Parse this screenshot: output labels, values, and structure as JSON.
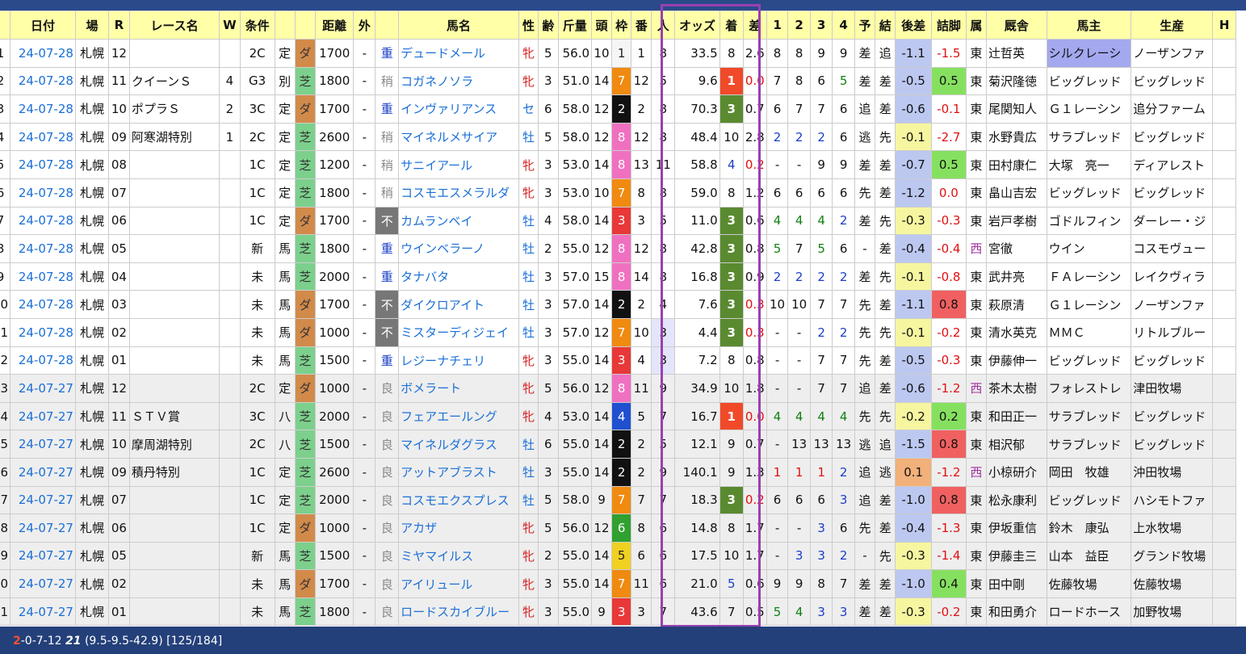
{
  "headers": [
    "",
    "日付",
    "場",
    "R",
    "レース名",
    "W",
    "条件",
    "",
    "",
    "距離",
    "外",
    "",
    "馬名",
    "性",
    "齢",
    "斤量",
    "頭",
    "枠",
    "番",
    "人",
    "オッズ",
    "着",
    "差",
    "1",
    "2",
    "3",
    "4",
    "予",
    "結",
    "後差",
    "詰脚",
    "属",
    "厩舎",
    "馬主",
    "生産",
    "H"
  ],
  "rows": [
    {
      "no": "1",
      "date": "24-07-28",
      "place": "札幌",
      "r": "12",
      "race": "",
      "w": "",
      "cls": "2C",
      "kind": "定",
      "surf": "ダ",
      "dist": "1700",
      "out": "-",
      "track": "重",
      "horse": "デュードメール",
      "sex": "牝",
      "age": "5",
      "wt": "56.0",
      "heads": "10",
      "gate": "1",
      "num": "1",
      "pop": "8",
      "odds": "33.5",
      "pos": "8",
      "diff": "2.6",
      "c1": "8",
      "c2": "8",
      "c3": "9",
      "c4": "9",
      "yo": "差",
      "res": "追",
      "ato": "-1.1",
      "tsume": "-1.5",
      "zoku": "東",
      "trainer": "辻哲英",
      "owner": "シルクレーシ",
      "breeder": "ノーザンファ"
    },
    {
      "no": "2",
      "date": "24-07-28",
      "place": "札幌",
      "r": "11",
      "race": "クイーンＳ",
      "w": "4",
      "cls": "G3",
      "kind": "別",
      "surf": "芝",
      "dist": "1800",
      "out": "-",
      "track": "稍",
      "horse": "コガネノソラ",
      "sex": "牝",
      "age": "3",
      "wt": "51.0",
      "heads": "14",
      "gate": "7",
      "num": "12",
      "pop": "5",
      "odds": "9.6",
      "pos": "1",
      "diff": "0.0",
      "c1": "7",
      "c2": "8",
      "c3": "6",
      "c4": "5",
      "yo": "差",
      "res": "差",
      "ato": "-0.5",
      "tsume": "0.5",
      "zoku": "東",
      "trainer": "菊沢隆徳",
      "owner": "ビッグレッド",
      "breeder": "ビッグレッド"
    },
    {
      "no": "3",
      "date": "24-07-28",
      "place": "札幌",
      "r": "10",
      "race": "ポプラＳ",
      "w": "2",
      "cls": "3C",
      "kind": "定",
      "surf": "ダ",
      "dist": "1700",
      "out": "-",
      "track": "重",
      "horse": "インヴァリアンス",
      "sex": "セ",
      "age": "6",
      "wt": "58.0",
      "heads": "12",
      "gate": "2",
      "num": "2",
      "pop": "8",
      "odds": "70.3",
      "pos": "3",
      "diff": "0.7",
      "c1": "6",
      "c2": "7",
      "c3": "7",
      "c4": "6",
      "yo": "追",
      "res": "差",
      "ato": "-0.6",
      "tsume": "-0.1",
      "zoku": "東",
      "trainer": "尾関知人",
      "owner": "Ｇ１レーシン",
      "breeder": "追分ファーム"
    },
    {
      "no": "4",
      "date": "24-07-28",
      "place": "札幌",
      "r": "09",
      "race": "阿寒湖特別",
      "w": "1",
      "cls": "2C",
      "kind": "定",
      "surf": "芝",
      "dist": "2600",
      "out": "-",
      "track": "稍",
      "horse": "マイネルメサイア",
      "sex": "牡",
      "age": "5",
      "wt": "58.0",
      "heads": "12",
      "gate": "8",
      "num": "12",
      "pop": "8",
      "odds": "48.4",
      "pos": "10",
      "diff": "2.8",
      "c1": "2",
      "c2": "2",
      "c3": "2",
      "c4": "6",
      "yo": "逃",
      "res": "先",
      "ato": "-0.1",
      "tsume": "-2.7",
      "zoku": "東",
      "trainer": "水野貴広",
      "owner": "サラブレッド",
      "breeder": "ビッグレッド"
    },
    {
      "no": "5",
      "date": "24-07-28",
      "place": "札幌",
      "r": "08",
      "race": "",
      "w": "",
      "cls": "1C",
      "kind": "定",
      "surf": "芝",
      "dist": "1200",
      "out": "-",
      "track": "稍",
      "horse": "サニイアール",
      "sex": "牝",
      "age": "3",
      "wt": "53.0",
      "heads": "14",
      "gate": "8",
      "num": "13",
      "pop": "11",
      "odds": "58.8",
      "pos": "4",
      "diff": "0.2",
      "c1": "-",
      "c2": "-",
      "c3": "9",
      "c4": "9",
      "yo": "差",
      "res": "差",
      "ato": "-0.7",
      "tsume": "0.5",
      "zoku": "東",
      "trainer": "田村康仁",
      "owner": "大塚　亮一",
      "breeder": "ディアレスト"
    },
    {
      "no": "6",
      "date": "24-07-28",
      "place": "札幌",
      "r": "07",
      "race": "",
      "w": "",
      "cls": "1C",
      "kind": "定",
      "surf": "芝",
      "dist": "1800",
      "out": "-",
      "track": "稍",
      "horse": "コスモエスメラルダ",
      "sex": "牝",
      "age": "3",
      "wt": "53.0",
      "heads": "10",
      "gate": "7",
      "num": "8",
      "pop": "8",
      "odds": "59.0",
      "pos": "8",
      "diff": "1.2",
      "c1": "6",
      "c2": "6",
      "c3": "6",
      "c4": "6",
      "yo": "先",
      "res": "差",
      "ato": "-1.2",
      "tsume": "0.0",
      "zoku": "東",
      "trainer": "畠山吉宏",
      "owner": "ビッグレッド",
      "breeder": "ビッグレッド"
    },
    {
      "no": "7",
      "date": "24-07-28",
      "place": "札幌",
      "r": "06",
      "race": "",
      "w": "",
      "cls": "1C",
      "kind": "定",
      "surf": "ダ",
      "dist": "1700",
      "out": "-",
      "track": "不",
      "horse": "カムランベイ",
      "sex": "牡",
      "age": "4",
      "wt": "58.0",
      "heads": "14",
      "gate": "3",
      "num": "3",
      "pop": "5",
      "odds": "11.0",
      "pos": "3",
      "diff": "0.6",
      "c1": "4",
      "c2": "4",
      "c3": "4",
      "c4": "2",
      "yo": "差",
      "res": "先",
      "ato": "-0.3",
      "tsume": "-0.3",
      "zoku": "東",
      "trainer": "岩戸孝樹",
      "owner": "ゴドルフィン",
      "breeder": "ダーレー・ジ"
    },
    {
      "no": "8",
      "date": "24-07-28",
      "place": "札幌",
      "r": "05",
      "race": "",
      "w": "",
      "cls": "新",
      "kind": "馬",
      "surf": "芝",
      "dist": "1800",
      "out": "-",
      "track": "重",
      "horse": "ウインベラーノ",
      "sex": "牡",
      "age": "2",
      "wt": "55.0",
      "heads": "12",
      "gate": "8",
      "num": "12",
      "pop": "8",
      "odds": "42.8",
      "pos": "3",
      "diff": "0.8",
      "c1": "5",
      "c2": "7",
      "c3": "5",
      "c4": "6",
      "yo": "-",
      "res": "差",
      "ato": "-0.4",
      "tsume": "-0.4",
      "zoku": "西",
      "trainer": "宮徹",
      "owner": "ウイン",
      "breeder": "コスモヴュー"
    },
    {
      "no": "9",
      "date": "24-07-28",
      "place": "札幌",
      "r": "04",
      "race": "",
      "w": "",
      "cls": "未",
      "kind": "馬",
      "surf": "芝",
      "dist": "2000",
      "out": "-",
      "track": "重",
      "horse": "タナバタ",
      "sex": "牡",
      "age": "3",
      "wt": "57.0",
      "heads": "15",
      "gate": "8",
      "num": "14",
      "pop": "8",
      "odds": "16.8",
      "pos": "3",
      "diff": "0.9",
      "c1": "2",
      "c2": "2",
      "c3": "2",
      "c4": "2",
      "yo": "差",
      "res": "先",
      "ato": "-0.1",
      "tsume": "-0.8",
      "zoku": "東",
      "trainer": "武井亮",
      "owner": "ＦＡレーシン",
      "breeder": "レイクヴィラ"
    },
    {
      "no": "10",
      "date": "24-07-28",
      "place": "札幌",
      "r": "03",
      "race": "",
      "w": "",
      "cls": "未",
      "kind": "馬",
      "surf": "ダ",
      "dist": "1700",
      "out": "-",
      "track": "不",
      "horse": "ダイクロアイト",
      "sex": "牡",
      "age": "3",
      "wt": "57.0",
      "heads": "14",
      "gate": "2",
      "num": "2",
      "pop": "4",
      "odds": "7.6",
      "pos": "3",
      "diff": "0.3",
      "c1": "10",
      "c2": "10",
      "c3": "7",
      "c4": "7",
      "yo": "先",
      "res": "差",
      "ato": "-1.1",
      "tsume": "0.8",
      "zoku": "東",
      "trainer": "萩原清",
      "owner": "Ｇ１レーシン",
      "breeder": "ノーザンファ"
    },
    {
      "no": "11",
      "date": "24-07-28",
      "place": "札幌",
      "r": "02",
      "race": "",
      "w": "",
      "cls": "未",
      "kind": "馬",
      "surf": "ダ",
      "dist": "1000",
      "out": "-",
      "track": "不",
      "horse": "ミスターディジェイ",
      "sex": "牡",
      "age": "3",
      "wt": "57.0",
      "heads": "12",
      "gate": "7",
      "num": "10",
      "pop": "3",
      "odds": "4.4",
      "pos": "3",
      "diff": "0.3",
      "c1": "-",
      "c2": "-",
      "c3": "2",
      "c4": "2",
      "yo": "先",
      "res": "先",
      "ato": "-0.1",
      "tsume": "-0.2",
      "zoku": "東",
      "trainer": "清水英克",
      "owner": "ＭＭＣ",
      "breeder": "リトルブルー"
    },
    {
      "no": "12",
      "date": "24-07-28",
      "place": "札幌",
      "r": "01",
      "race": "",
      "w": "",
      "cls": "未",
      "kind": "馬",
      "surf": "芝",
      "dist": "1500",
      "out": "-",
      "track": "重",
      "horse": "レジーナチェリ",
      "sex": "牝",
      "age": "3",
      "wt": "55.0",
      "heads": "14",
      "gate": "3",
      "num": "4",
      "pop": "3",
      "odds": "7.2",
      "pos": "8",
      "diff": "0.8",
      "c1": "-",
      "c2": "-",
      "c3": "7",
      "c4": "7",
      "yo": "先",
      "res": "差",
      "ato": "-0.5",
      "tsume": "-0.3",
      "zoku": "東",
      "trainer": "伊藤伸一",
      "owner": "ビッグレッド",
      "breeder": "ビッグレッド"
    },
    {
      "no": "13",
      "date": "24-07-27",
      "place": "札幌",
      "r": "12",
      "race": "",
      "w": "",
      "cls": "2C",
      "kind": "定",
      "surf": "ダ",
      "dist": "1000",
      "out": "-",
      "track": "良",
      "horse": "ボメラート",
      "sex": "牝",
      "age": "5",
      "wt": "56.0",
      "heads": "12",
      "gate": "8",
      "num": "11",
      "pop": "9",
      "odds": "34.9",
      "pos": "10",
      "diff": "1.8",
      "c1": "-",
      "c2": "-",
      "c3": "7",
      "c4": "7",
      "yo": "追",
      "res": "差",
      "ato": "-0.6",
      "tsume": "-1.2",
      "zoku": "西",
      "trainer": "茶木太樹",
      "owner": "フォレストレ",
      "breeder": "津田牧場"
    },
    {
      "no": "14",
      "date": "24-07-27",
      "place": "札幌",
      "r": "11",
      "race": "ＳＴＶ賞",
      "w": "",
      "cls": "3C",
      "kind": "八",
      "surf": "芝",
      "dist": "2000",
      "out": "-",
      "track": "良",
      "horse": "フェアエールング",
      "sex": "牝",
      "age": "4",
      "wt": "53.0",
      "heads": "14",
      "gate": "4",
      "num": "5",
      "pop": "7",
      "odds": "16.7",
      "pos": "1",
      "diff": "0.0",
      "c1": "4",
      "c2": "4",
      "c3": "4",
      "c4": "4",
      "yo": "先",
      "res": "先",
      "ato": "-0.2",
      "tsume": "0.2",
      "zoku": "東",
      "trainer": "和田正一",
      "owner": "サラブレッド",
      "breeder": "ビッグレッド"
    },
    {
      "no": "15",
      "date": "24-07-27",
      "place": "札幌",
      "r": "10",
      "race": "摩周湖特別",
      "w": "",
      "cls": "2C",
      "kind": "八",
      "surf": "芝",
      "dist": "1500",
      "out": "-",
      "track": "良",
      "horse": "マイネルダグラス",
      "sex": "牡",
      "age": "6",
      "wt": "55.0",
      "heads": "14",
      "gate": "2",
      "num": "2",
      "pop": "5",
      "odds": "12.1",
      "pos": "9",
      "diff": "0.7",
      "c1": "-",
      "c2": "13",
      "c3": "13",
      "c4": "13",
      "yo": "逃",
      "res": "追",
      "ato": "-1.5",
      "tsume": "0.8",
      "zoku": "東",
      "trainer": "相沢郁",
      "owner": "サラブレッド",
      "breeder": "ビッグレッド"
    },
    {
      "no": "16",
      "date": "24-07-27",
      "place": "札幌",
      "r": "09",
      "race": "積丹特別",
      "w": "",
      "cls": "1C",
      "kind": "定",
      "surf": "芝",
      "dist": "2600",
      "out": "-",
      "track": "良",
      "horse": "アットアブラスト",
      "sex": "牡",
      "age": "3",
      "wt": "55.0",
      "heads": "14",
      "gate": "2",
      "num": "2",
      "pop": "9",
      "odds": "140.1",
      "pos": "9",
      "diff": "1.3",
      "c1": "1",
      "c2": "1",
      "c3": "1",
      "c4": "2",
      "yo": "追",
      "res": "逃",
      "ato": "0.1",
      "tsume": "-1.2",
      "zoku": "西",
      "trainer": "小椋研介",
      "owner": "岡田　牧雄",
      "breeder": "沖田牧場"
    },
    {
      "no": "17",
      "date": "24-07-27",
      "place": "札幌",
      "r": "07",
      "race": "",
      "w": "",
      "cls": "1C",
      "kind": "定",
      "surf": "芝",
      "dist": "2000",
      "out": "-",
      "track": "良",
      "horse": "コスモエクスプレス",
      "sex": "牡",
      "age": "5",
      "wt": "58.0",
      "heads": "9",
      "gate": "7",
      "num": "7",
      "pop": "7",
      "odds": "18.3",
      "pos": "3",
      "diff": "0.2",
      "c1": "6",
      "c2": "6",
      "c3": "6",
      "c4": "3",
      "yo": "追",
      "res": "差",
      "ato": "-1.0",
      "tsume": "0.8",
      "zoku": "東",
      "trainer": "松永康利",
      "owner": "ビッグレッド",
      "breeder": "ハシモトファ"
    },
    {
      "no": "18",
      "date": "24-07-27",
      "place": "札幌",
      "r": "06",
      "race": "",
      "w": "",
      "cls": "1C",
      "kind": "定",
      "surf": "ダ",
      "dist": "1000",
      "out": "-",
      "track": "良",
      "horse": "アカザ",
      "sex": "牝",
      "age": "5",
      "wt": "56.0",
      "heads": "12",
      "gate": "6",
      "num": "8",
      "pop": "6",
      "odds": "14.8",
      "pos": "8",
      "diff": "1.7",
      "c1": "-",
      "c2": "-",
      "c3": "3",
      "c4": "6",
      "yo": "先",
      "res": "差",
      "ato": "-0.4",
      "tsume": "-1.3",
      "zoku": "東",
      "trainer": "伊坂重信",
      "owner": "鈴木　康弘",
      "breeder": "上水牧場"
    },
    {
      "no": "19",
      "date": "24-07-27",
      "place": "札幌",
      "r": "05",
      "race": "",
      "w": "",
      "cls": "新",
      "kind": "馬",
      "surf": "芝",
      "dist": "1500",
      "out": "-",
      "track": "良",
      "horse": "ミヤマイルス",
      "sex": "牝",
      "age": "2",
      "wt": "55.0",
      "heads": "14",
      "gate": "5",
      "num": "6",
      "pop": "6",
      "odds": "17.5",
      "pos": "10",
      "diff": "1.7",
      "c1": "-",
      "c2": "3",
      "c3": "3",
      "c4": "2",
      "yo": "-",
      "res": "先",
      "ato": "-0.3",
      "tsume": "-1.4",
      "zoku": "東",
      "trainer": "伊藤圭三",
      "owner": "山本　益臣",
      "breeder": "グランド牧場"
    },
    {
      "no": "20",
      "date": "24-07-27",
      "place": "札幌",
      "r": "02",
      "race": "",
      "w": "",
      "cls": "未",
      "kind": "馬",
      "surf": "ダ",
      "dist": "1700",
      "out": "-",
      "track": "良",
      "horse": "アイリュール",
      "sex": "牝",
      "age": "3",
      "wt": "55.0",
      "heads": "14",
      "gate": "7",
      "num": "11",
      "pop": "6",
      "odds": "21.0",
      "pos": "5",
      "diff": "0.6",
      "c1": "9",
      "c2": "9",
      "c3": "8",
      "c4": "7",
      "yo": "差",
      "res": "差",
      "ato": "-1.0",
      "tsume": "0.4",
      "zoku": "東",
      "trainer": "田中剛",
      "owner": "佐藤牧場",
      "breeder": "佐藤牧場"
    },
    {
      "no": "21",
      "date": "24-07-27",
      "place": "札幌",
      "r": "01",
      "race": "",
      "w": "",
      "cls": "未",
      "kind": "馬",
      "surf": "芝",
      "dist": "1800",
      "out": "-",
      "track": "良",
      "horse": "ロードスカイブルー",
      "sex": "牝",
      "age": "3",
      "wt": "55.0",
      "heads": "9",
      "gate": "3",
      "num": "3",
      "pop": "7",
      "odds": "43.6",
      "pos": "7",
      "diff": "0.5",
      "c1": "5",
      "c2": "4",
      "c3": "3",
      "c4": "3",
      "yo": "差",
      "res": "差",
      "ato": "-0.3",
      "tsume": "-0.2",
      "zoku": "東",
      "trainer": "和田勇介",
      "owner": "ロードホース",
      "breeder": "加野牧場"
    }
  ],
  "footer": {
    "hit": "2",
    "record": "-0-7-12",
    "total": "21",
    "detail": "(9.5-9.5-42.9) [125/184]"
  },
  "colors": {
    "header_bg": "#ffffa8",
    "top_bar": "#2a4a8a",
    "footer_bg": "#24407a",
    "highlight_box": "#9a40b0",
    "link": "#1a6fd6"
  }
}
